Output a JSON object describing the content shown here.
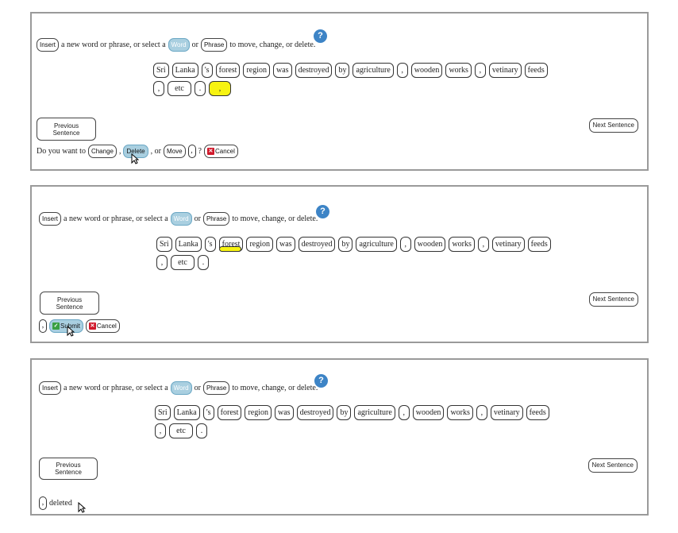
{
  "instruction": {
    "insert_label": "Insert",
    "text_before_word": "a new word or phrase, or select a",
    "word_label": "Word",
    "or": "or",
    "phrase_label": "Phrase",
    "text_after": "to move, change, or delete."
  },
  "help_label": "?",
  "tokens_row1": [
    "Sri",
    "Lanka",
    "'s",
    "forest",
    "region",
    "was",
    "destroyed",
    "by",
    "agriculture",
    ",",
    "wooden",
    "works",
    ",",
    "vetinary",
    "feeds"
  ],
  "tokens_row2": [
    ",",
    "etc",
    "."
  ],
  "panel1": {
    "selected_token": ",",
    "prev_label_line1": "Previous",
    "prev_label_line2": "Sentence",
    "next_label": "Next Sentence",
    "question_prefix": "Do you want to",
    "change_label": "Change",
    "comma": ",",
    "delete_label": "Delete",
    "or_text": ", or",
    "move_label": "Move",
    "token": ",",
    "question_mark": "?",
    "cancel_label": "Cancel"
  },
  "panel2": {
    "prev_label_line1": "Previous",
    "prev_label_line2": "Sentence",
    "next_label": "Next Sentence",
    "token": ",",
    "submit_label": "Submit",
    "cancel_label": "Cancel"
  },
  "panel3": {
    "prev_label_line1": "Previous",
    "prev_label_line2": "Sentence",
    "next_label": "Next Sentence",
    "token": ",",
    "status_text": "deleted"
  },
  "colors": {
    "highlight": "#f7f311",
    "selected_button": "#a9cfe0",
    "help": "#3d84c6",
    "cancel_icon": "#d0192b",
    "submit_icon": "#39a043"
  }
}
